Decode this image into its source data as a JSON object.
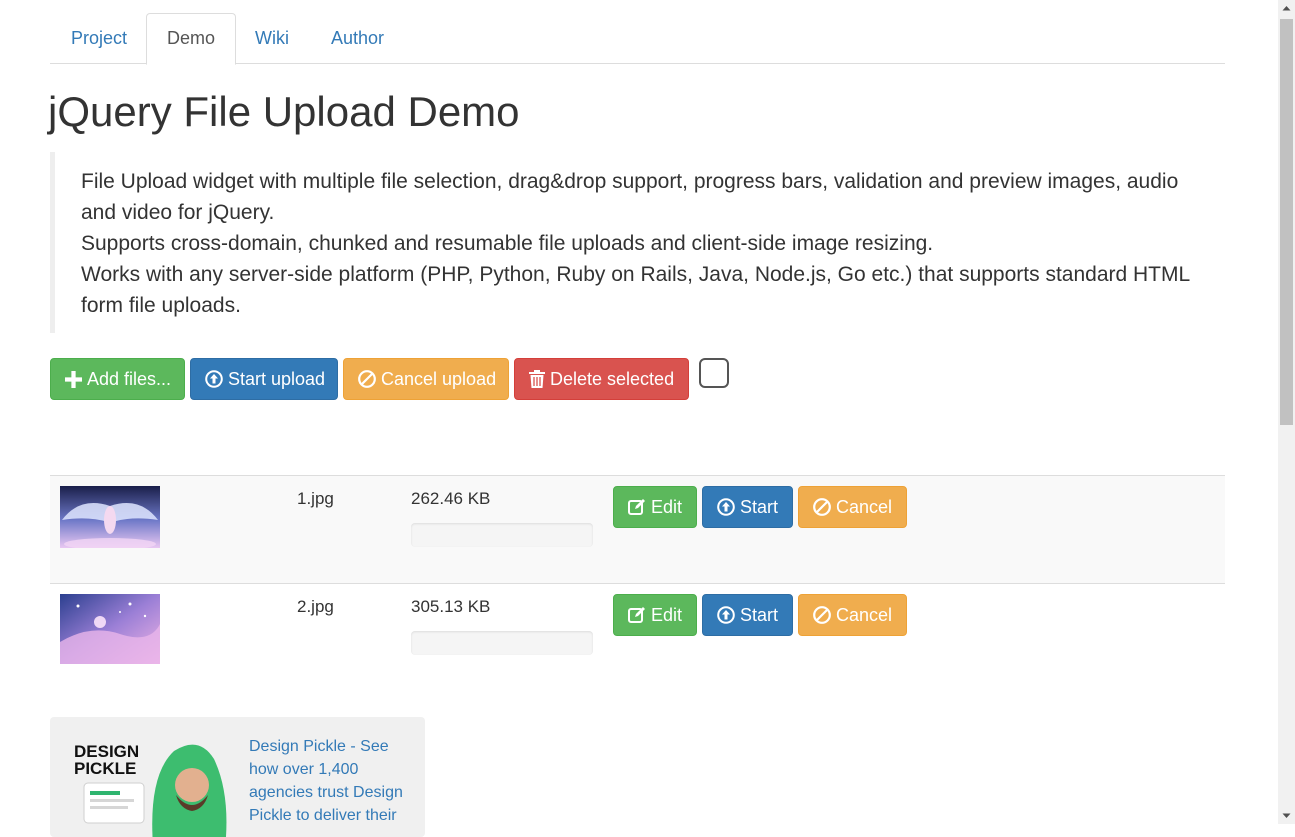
{
  "tabs": [
    {
      "label": "Project"
    },
    {
      "label": "Demo",
      "active": true
    },
    {
      "label": "Wiki"
    },
    {
      "label": "Author"
    }
  ],
  "title": "jQuery File Upload Demo",
  "description": [
    "File Upload widget with multiple file selection, drag&drop support, progress bars, validation and preview images, audio and video for jQuery.",
    "Supports cross-domain, chunked and resumable file uploads and client-side image resizing.",
    "Works with any server-side platform (PHP, Python, Ruby on Rails, Java, Node.js, Go etc.) that supports standard HTML form file uploads."
  ],
  "toolbar": {
    "add_label": "Add files...",
    "start_label": "Start upload",
    "cancel_label": "Cancel upload",
    "delete_label": "Delete selected",
    "select_all_checked": false
  },
  "files": [
    {
      "name": "1.jpg",
      "size": "262.46 KB",
      "progress": 0,
      "edit_label": "Edit",
      "start_label": "Start",
      "cancel_label": "Cancel"
    },
    {
      "name": "2.jpg",
      "size": "305.13 KB",
      "progress": 0,
      "edit_label": "Edit",
      "start_label": "Start",
      "cancel_label": "Cancel"
    }
  ],
  "ad": {
    "logo_text": "DESIGN PICKLE",
    "text": "Design Pickle - See how over 1,400 agencies trust Design Pickle to deliver their"
  },
  "colors": {
    "success": "#5cb85c",
    "primary": "#337ab7",
    "warning": "#f0ad4e",
    "danger": "#d9534f",
    "link": "#337ab7"
  },
  "icons": {
    "add": "plus-icon",
    "start": "upload-circle-icon",
    "cancel": "ban-circle-icon",
    "delete": "trash-icon",
    "edit": "edit-icon"
  }
}
